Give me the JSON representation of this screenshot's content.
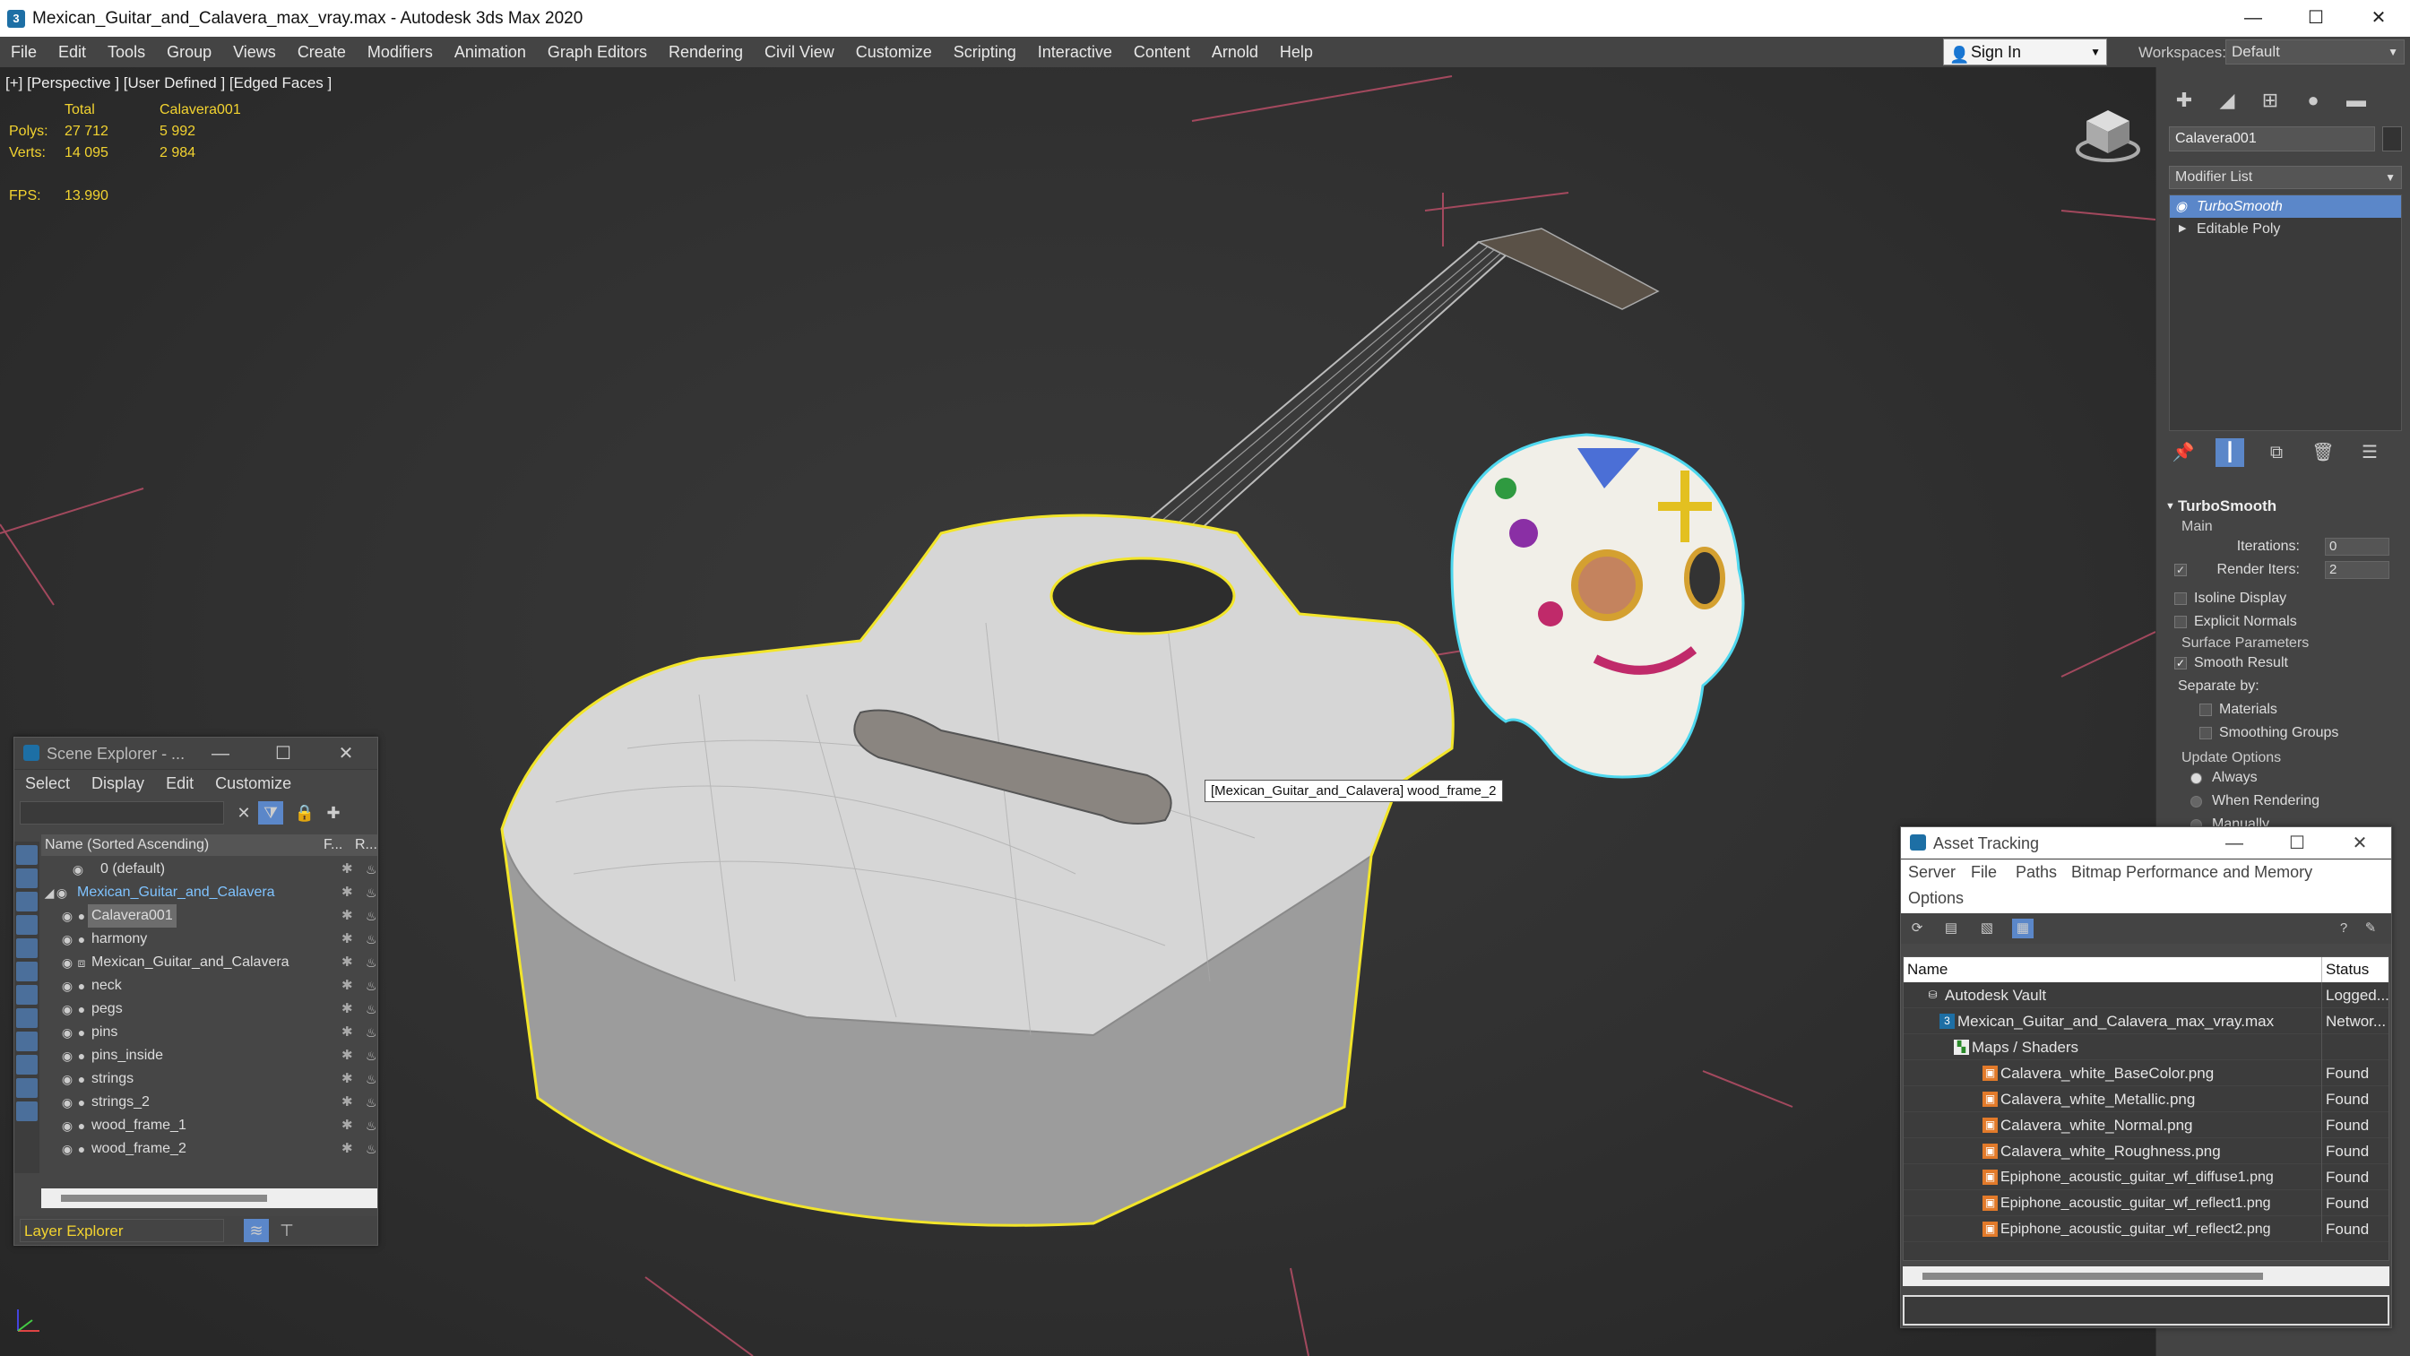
{
  "window": {
    "title": "Mexican_Guitar_and_Calavera_max_vray.max - Autodesk 3ds Max 2020",
    "app_icon": "3",
    "min": "—",
    "max": "☐",
    "close": "✕"
  },
  "menu": [
    "File",
    "Edit",
    "Tools",
    "Group",
    "Views",
    "Create",
    "Modifiers",
    "Animation",
    "Graph Editors",
    "Rendering",
    "Civil View",
    "Customize",
    "Scripting",
    "Interactive",
    "Content",
    "Arnold",
    "Help"
  ],
  "signin": {
    "label": "Sign In"
  },
  "workspace": {
    "label": "Workspaces:",
    "value": "Default"
  },
  "viewport": {
    "label": "[+] [Perspective ] [User Defined ] [Edged Faces ]",
    "stats": {
      "header": [
        "",
        "Total",
        "Calavera001"
      ],
      "rows": [
        [
          "Polys:",
          "27 712",
          "5 992"
        ],
        [
          "Verts:",
          "14 095",
          "2 984"
        ]
      ],
      "fps_label": "FPS:",
      "fps_value": "13.990"
    },
    "tooltip": "[Mexican_Guitar_and_Calavera] wood_frame_2",
    "colors": {
      "selection": "#f2e52a",
      "skull_selection": "#4fd8ef",
      "grid": "#c0506a"
    }
  },
  "command_panel": {
    "object_name": "Calavera001",
    "modifier_list": "Modifier List",
    "stack": [
      "TurboSmooth",
      "Editable Poly"
    ],
    "rollout": {
      "title": "TurboSmooth",
      "main": "Main",
      "iterations_label": "Iterations:",
      "iterations": "0",
      "render_iters_label": "Render Iters:",
      "render_iters": "2",
      "isoline": "Isoline Display",
      "explicit_normals": "Explicit Normals",
      "surface": "Surface Parameters",
      "smooth_result": "Smooth Result",
      "separate_by": "Separate by:",
      "materials": "Materials",
      "smoothing_groups": "Smoothing Groups",
      "update": "Update Options",
      "always": "Always",
      "when_rendering": "When Rendering",
      "manually": "Manually"
    }
  },
  "scene_explorer": {
    "title": "Scene Explorer - ...",
    "menu": [
      "Select",
      "Display",
      "Edit",
      "Customize"
    ],
    "columns": [
      "Name (Sorted Ascending)",
      "F...",
      "R..."
    ],
    "rows": [
      {
        "name": "0 (default)",
        "level": 1
      },
      {
        "name": "Mexican_Guitar_and_Calavera",
        "level": 1
      },
      {
        "name": "Calavera001",
        "level": 2
      },
      {
        "name": "harmony",
        "level": 2
      },
      {
        "name": "Mexican_Guitar_and_Calavera",
        "level": 2
      },
      {
        "name": "neck",
        "level": 2
      },
      {
        "name": "pegs",
        "level": 2
      },
      {
        "name": "pins",
        "level": 2
      },
      {
        "name": "pins_inside",
        "level": 2
      },
      {
        "name": "strings",
        "level": 2
      },
      {
        "name": "strings_2",
        "level": 2
      },
      {
        "name": "wood_frame_1",
        "level": 2
      },
      {
        "name": "wood_frame_2",
        "level": 2
      }
    ],
    "layer_explorer": "Layer Explorer"
  },
  "asset_tracking": {
    "title": "Asset Tracking",
    "menu": [
      "Server",
      "File",
      "Paths",
      "Bitmap Performance and Memory",
      "Options"
    ],
    "columns": [
      "Name",
      "Status"
    ],
    "rows": [
      {
        "name": "Autodesk Vault",
        "status": "Logged..."
      },
      {
        "name": "Mexican_Guitar_and_Calavera_max_vray.max",
        "status": "Networ..."
      },
      {
        "name": "Maps / Shaders",
        "status": ""
      },
      {
        "name": "Calavera_white_BaseColor.png",
        "status": "Found"
      },
      {
        "name": "Calavera_white_Metallic.png",
        "status": "Found"
      },
      {
        "name": "Calavera_white_Normal.png",
        "status": "Found"
      },
      {
        "name": "Calavera_white_Roughness.png",
        "status": "Found"
      },
      {
        "name": "Epiphone_acoustic_guitar_wf_diffuse1.png",
        "status": "Found"
      },
      {
        "name": "Epiphone_acoustic_guitar_wf_reflect1.png",
        "status": "Found"
      },
      {
        "name": "Epiphone_acoustic_guitar_wf_reflect2.png",
        "status": "Found"
      }
    ]
  }
}
